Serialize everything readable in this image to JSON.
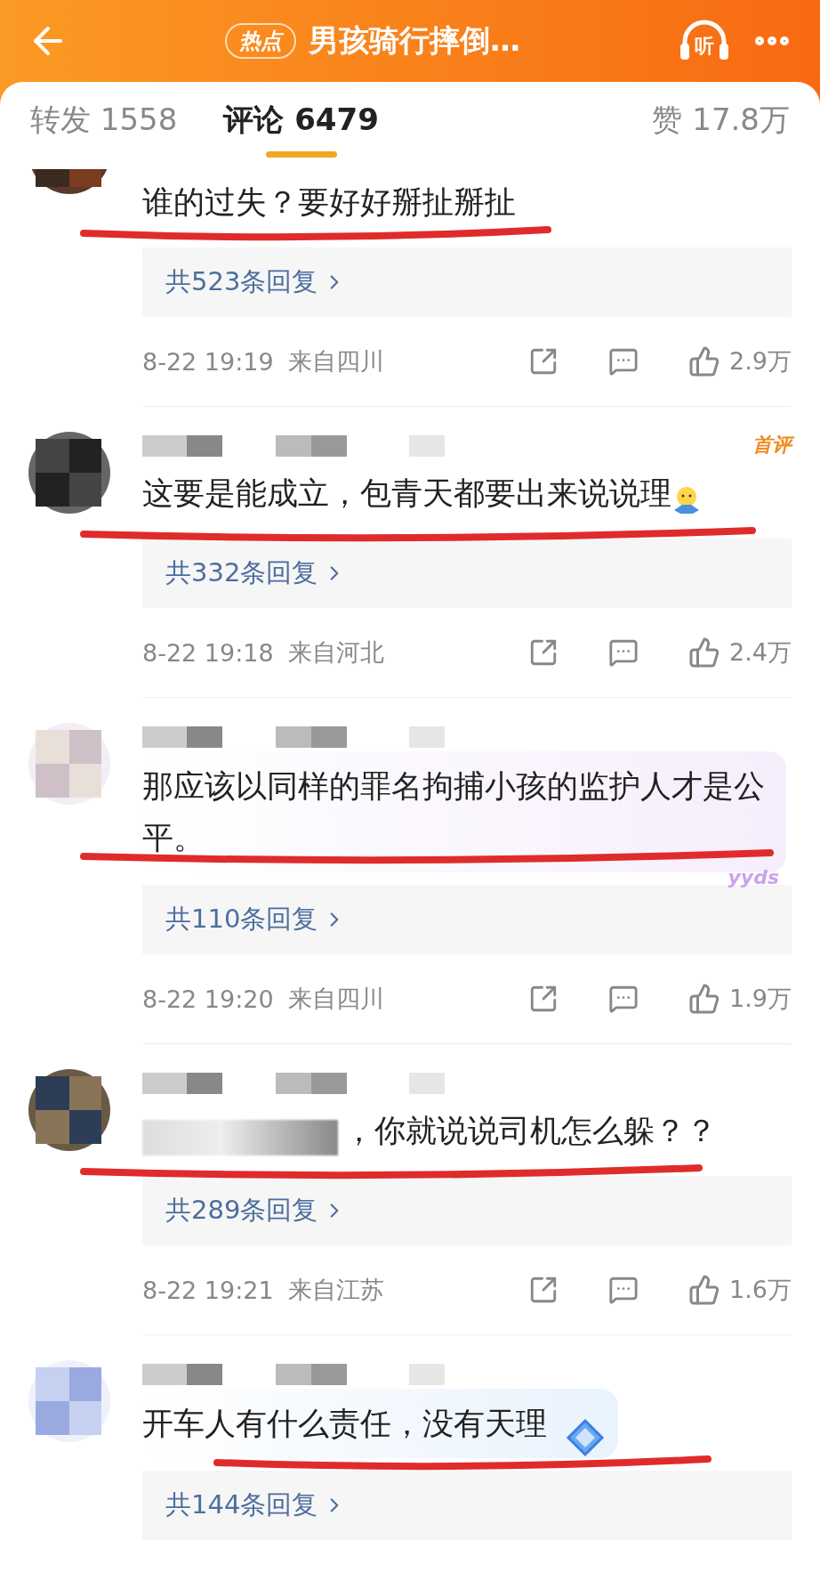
{
  "header": {
    "badge": "热点",
    "title": "男孩骑行摔倒…",
    "listen_label": "听"
  },
  "tabs": [
    {
      "label": "转发 1558",
      "selected": false
    },
    {
      "label": "评论 6479",
      "selected": true
    },
    {
      "label": "赞 17.8万",
      "selected": false
    }
  ],
  "comments": [
    {
      "kind": "plain",
      "cut_top": true,
      "censored_prefix": false,
      "text": "谁的过失？要好好掰扯掰扯",
      "replies": "共523条回复",
      "time": "8-22 19:19",
      "location": "来自四川",
      "likes": "2.9万"
    },
    {
      "kind": "plain",
      "cut_top": false,
      "first_badge": "首评",
      "censored_prefix": false,
      "text": "这要是能成立，包青天都要出来说说理",
      "emoji": true,
      "replies": "共332条回复",
      "time": "8-22 19:18",
      "location": "来自河北",
      "likes": "2.4万"
    },
    {
      "kind": "sticker",
      "cut_top": false,
      "bubble_tag": "yyds",
      "censored_prefix": false,
      "text": "那应该以同样的罪名拘捕小孩的监护人才是公平。",
      "replies": "共110条回复",
      "time": "8-22 19:20",
      "location": "来自四川",
      "likes": "1.9万"
    },
    {
      "kind": "plain",
      "cut_top": false,
      "censored_prefix": true,
      "text": "，你就说说司机怎么躲？？",
      "replies": "共289条回复",
      "time": "8-22 19:21",
      "location": "来自江苏",
      "likes": "1.6万"
    },
    {
      "kind": "gem",
      "cut_top": false,
      "censored_prefix": false,
      "text": "开车人有什么责任，没有天理",
      "replies": "共144条回复"
    }
  ]
}
